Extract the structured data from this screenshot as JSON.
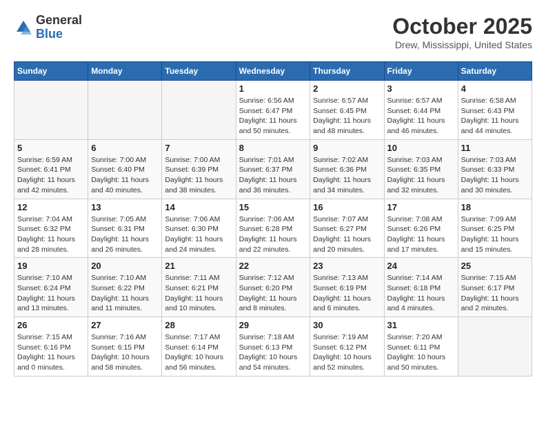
{
  "logo": {
    "general": "General",
    "blue": "Blue"
  },
  "title": "October 2025",
  "location": "Drew, Mississippi, United States",
  "days_of_week": [
    "Sunday",
    "Monday",
    "Tuesday",
    "Wednesday",
    "Thursday",
    "Friday",
    "Saturday"
  ],
  "weeks": [
    [
      {
        "day": "",
        "info": ""
      },
      {
        "day": "",
        "info": ""
      },
      {
        "day": "",
        "info": ""
      },
      {
        "day": "1",
        "info": "Sunrise: 6:56 AM\nSunset: 6:47 PM\nDaylight: 11 hours and 50 minutes."
      },
      {
        "day": "2",
        "info": "Sunrise: 6:57 AM\nSunset: 6:45 PM\nDaylight: 11 hours and 48 minutes."
      },
      {
        "day": "3",
        "info": "Sunrise: 6:57 AM\nSunset: 6:44 PM\nDaylight: 11 hours and 46 minutes."
      },
      {
        "day": "4",
        "info": "Sunrise: 6:58 AM\nSunset: 6:43 PM\nDaylight: 11 hours and 44 minutes."
      }
    ],
    [
      {
        "day": "5",
        "info": "Sunrise: 6:59 AM\nSunset: 6:41 PM\nDaylight: 11 hours and 42 minutes."
      },
      {
        "day": "6",
        "info": "Sunrise: 7:00 AM\nSunset: 6:40 PM\nDaylight: 11 hours and 40 minutes."
      },
      {
        "day": "7",
        "info": "Sunrise: 7:00 AM\nSunset: 6:39 PM\nDaylight: 11 hours and 38 minutes."
      },
      {
        "day": "8",
        "info": "Sunrise: 7:01 AM\nSunset: 6:37 PM\nDaylight: 11 hours and 36 minutes."
      },
      {
        "day": "9",
        "info": "Sunrise: 7:02 AM\nSunset: 6:36 PM\nDaylight: 11 hours and 34 minutes."
      },
      {
        "day": "10",
        "info": "Sunrise: 7:03 AM\nSunset: 6:35 PM\nDaylight: 11 hours and 32 minutes."
      },
      {
        "day": "11",
        "info": "Sunrise: 7:03 AM\nSunset: 6:33 PM\nDaylight: 11 hours and 30 minutes."
      }
    ],
    [
      {
        "day": "12",
        "info": "Sunrise: 7:04 AM\nSunset: 6:32 PM\nDaylight: 11 hours and 28 minutes."
      },
      {
        "day": "13",
        "info": "Sunrise: 7:05 AM\nSunset: 6:31 PM\nDaylight: 11 hours and 26 minutes."
      },
      {
        "day": "14",
        "info": "Sunrise: 7:06 AM\nSunset: 6:30 PM\nDaylight: 11 hours and 24 minutes."
      },
      {
        "day": "15",
        "info": "Sunrise: 7:06 AM\nSunset: 6:28 PM\nDaylight: 11 hours and 22 minutes."
      },
      {
        "day": "16",
        "info": "Sunrise: 7:07 AM\nSunset: 6:27 PM\nDaylight: 11 hours and 20 minutes."
      },
      {
        "day": "17",
        "info": "Sunrise: 7:08 AM\nSunset: 6:26 PM\nDaylight: 11 hours and 17 minutes."
      },
      {
        "day": "18",
        "info": "Sunrise: 7:09 AM\nSunset: 6:25 PM\nDaylight: 11 hours and 15 minutes."
      }
    ],
    [
      {
        "day": "19",
        "info": "Sunrise: 7:10 AM\nSunset: 6:24 PM\nDaylight: 11 hours and 13 minutes."
      },
      {
        "day": "20",
        "info": "Sunrise: 7:10 AM\nSunset: 6:22 PM\nDaylight: 11 hours and 11 minutes."
      },
      {
        "day": "21",
        "info": "Sunrise: 7:11 AM\nSunset: 6:21 PM\nDaylight: 11 hours and 10 minutes."
      },
      {
        "day": "22",
        "info": "Sunrise: 7:12 AM\nSunset: 6:20 PM\nDaylight: 11 hours and 8 minutes."
      },
      {
        "day": "23",
        "info": "Sunrise: 7:13 AM\nSunset: 6:19 PM\nDaylight: 11 hours and 6 minutes."
      },
      {
        "day": "24",
        "info": "Sunrise: 7:14 AM\nSunset: 6:18 PM\nDaylight: 11 hours and 4 minutes."
      },
      {
        "day": "25",
        "info": "Sunrise: 7:15 AM\nSunset: 6:17 PM\nDaylight: 11 hours and 2 minutes."
      }
    ],
    [
      {
        "day": "26",
        "info": "Sunrise: 7:15 AM\nSunset: 6:16 PM\nDaylight: 11 hours and 0 minutes."
      },
      {
        "day": "27",
        "info": "Sunrise: 7:16 AM\nSunset: 6:15 PM\nDaylight: 10 hours and 58 minutes."
      },
      {
        "day": "28",
        "info": "Sunrise: 7:17 AM\nSunset: 6:14 PM\nDaylight: 10 hours and 56 minutes."
      },
      {
        "day": "29",
        "info": "Sunrise: 7:18 AM\nSunset: 6:13 PM\nDaylight: 10 hours and 54 minutes."
      },
      {
        "day": "30",
        "info": "Sunrise: 7:19 AM\nSunset: 6:12 PM\nDaylight: 10 hours and 52 minutes."
      },
      {
        "day": "31",
        "info": "Sunrise: 7:20 AM\nSunset: 6:11 PM\nDaylight: 10 hours and 50 minutes."
      },
      {
        "day": "",
        "info": ""
      }
    ]
  ]
}
